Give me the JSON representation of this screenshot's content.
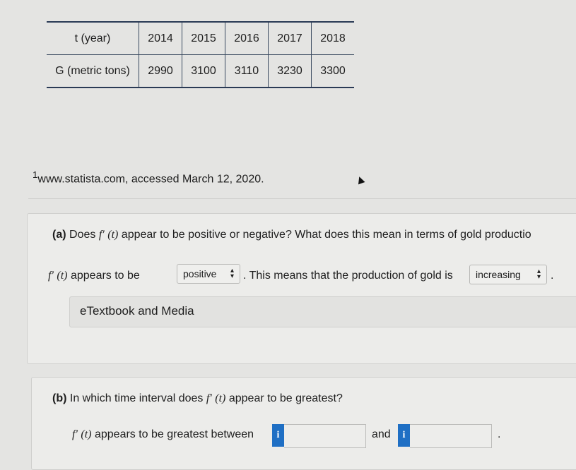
{
  "table": {
    "header": [
      "t (year)",
      "2014",
      "2015",
      "2016",
      "2017",
      "2018"
    ],
    "row": [
      "G (metric tons)",
      "2990",
      "3100",
      "3110",
      "3230",
      "3300"
    ]
  },
  "footnote": {
    "marker": "1",
    "text": "www.statista.com, accessed March 12, 2020."
  },
  "part_a": {
    "label": "(a)",
    "question_pre": "Does",
    "fprime": "f′",
    "t": "(t)",
    "question_post": "appear to be positive or negative? What does this mean in terms of gold productio",
    "answer_pre": "appears to be",
    "select1": "positive",
    "answer_mid": ". This means that the production of gold is",
    "select2": "increasing",
    "answer_end": "."
  },
  "etextbook": "eTextbook and Media",
  "part_b": {
    "label": "(b)",
    "question_pre": "In which time interval does",
    "question_post": "appear to be greatest?",
    "answer_pre": "appears to be greatest between",
    "and": "and",
    "end": ".",
    "info_icon": "i",
    "input1": "",
    "input2": ""
  }
}
